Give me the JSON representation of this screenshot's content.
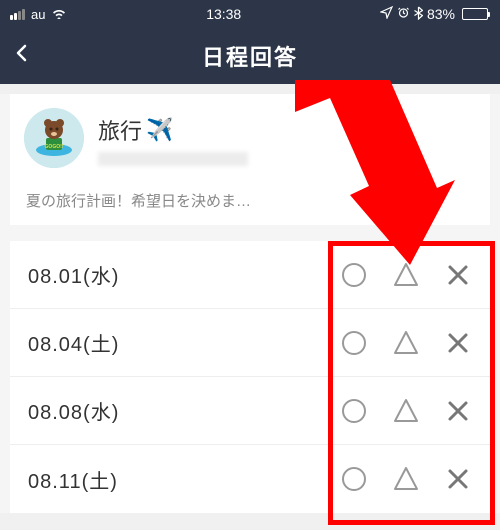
{
  "status": {
    "carrier": "au",
    "time": "13:38",
    "battery_pct": "83%"
  },
  "nav": {
    "title": "日程回答"
  },
  "event": {
    "title": "旅行",
    "description": "夏の旅行計画！希望日を決めま…"
  },
  "dates": [
    {
      "label": "08.01(水)"
    },
    {
      "label": "08.04(土)"
    },
    {
      "label": "08.08(水)"
    },
    {
      "label": "08.11(土)"
    }
  ]
}
